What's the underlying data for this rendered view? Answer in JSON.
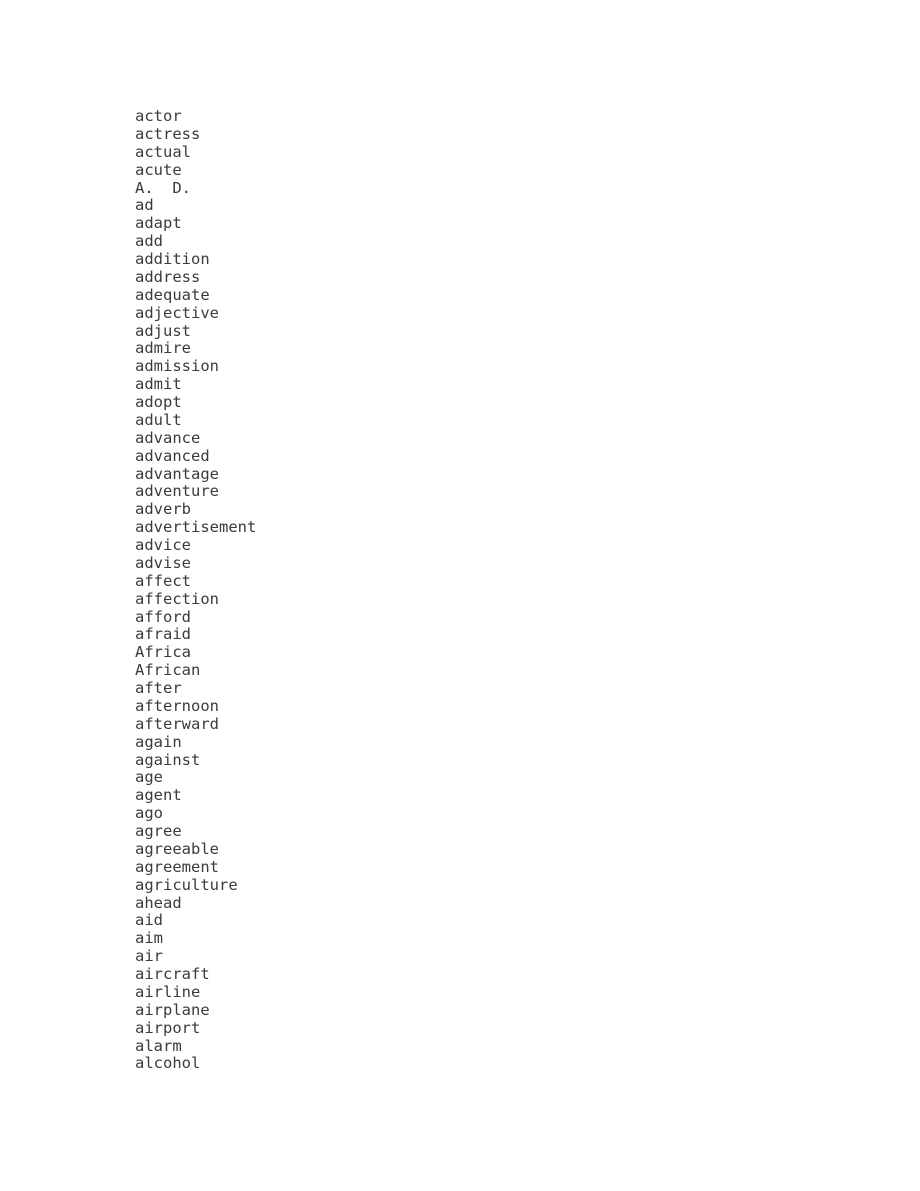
{
  "document": {
    "type": "word-list",
    "background_color": "#ffffff",
    "text_color": "#3b3b3b",
    "entries": [
      "actor",
      "actress",
      "actual",
      "acute",
      "A.  D.",
      "ad",
      "adapt",
      "add",
      "addition",
      "address",
      "adequate",
      "adjective",
      "adjust",
      "admire",
      "admission",
      "admit",
      "adopt",
      "adult",
      "advance",
      "advanced",
      "advantage",
      "adventure",
      "adverb",
      "advertisement",
      "advice",
      "advise",
      "affect",
      "affection",
      "afford",
      "afraid",
      "Africa",
      "African",
      "after",
      "afternoon",
      "afterward",
      "again",
      "against",
      "age",
      "agent",
      "ago",
      "agree",
      "agreeable",
      "agreement",
      "agriculture",
      "ahead",
      "aid",
      "aim",
      "air",
      "aircraft",
      "airline",
      "airplane",
      "airport",
      "alarm",
      "alcohol"
    ]
  }
}
